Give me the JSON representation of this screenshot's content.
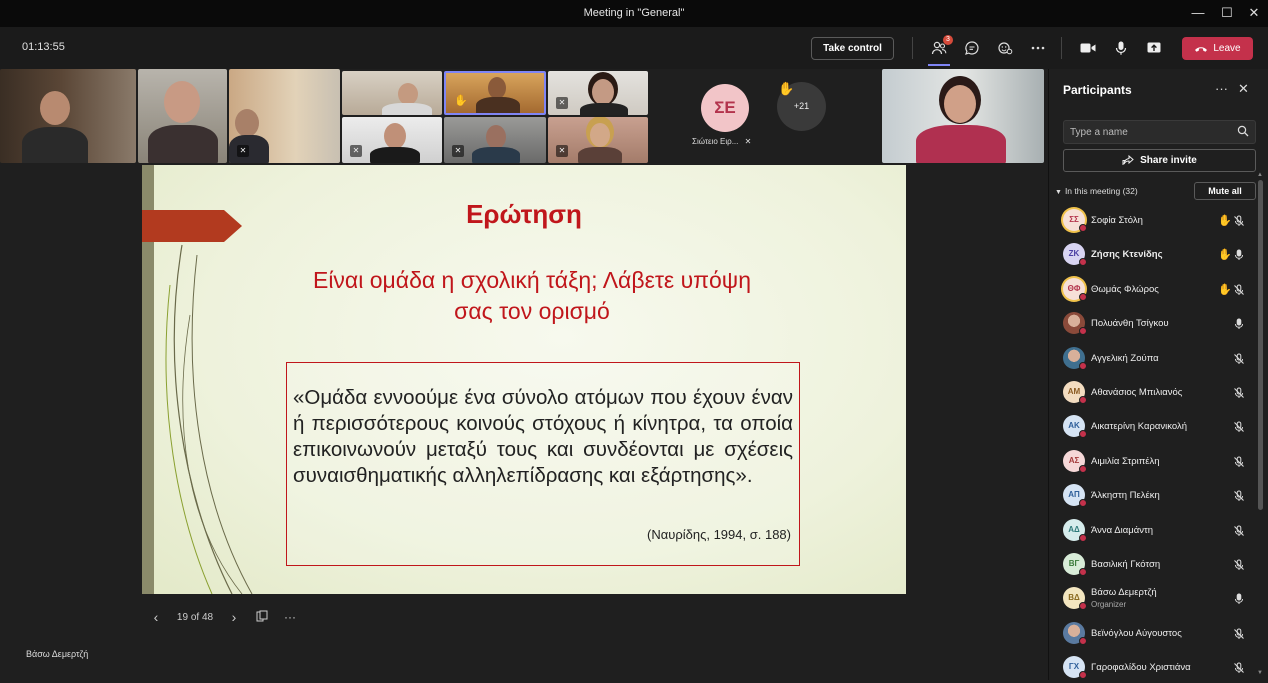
{
  "window": {
    "title": "Meeting in \"General\"",
    "minimize": "—",
    "maximize": "☐",
    "close": "✕"
  },
  "toolbar": {
    "timer": "01:13:55",
    "take_control_label": "Take control",
    "participants_badge": "3",
    "leave_label": "Leave"
  },
  "video_strip": {
    "tile_initials": "ΣΕ",
    "tile_name": "Σιώτειο Ειρ...",
    "overflow_count": "+21"
  },
  "slide": {
    "title": "Ερώτηση",
    "question": "Είναι ομάδα η σχολική τάξη; Λάβετε υπόψη σας τον ορισμό",
    "quote": "«Ομάδα εννοούμε ένα σύνολο ατόμων που έχουν έναν ή περισσότερους κοινούς στόχους ή κίνητρα, τα οποία επικοινωνούν μεταξύ τους και συνδέονται με σχέσεις συναισθηματικής αλληλεπίδρασης και εξάρτησης».",
    "citation": "(Ναυρίδης, 1994, σ. 188)"
  },
  "slide_nav": {
    "page_indicator": "19 of 48"
  },
  "presenter": {
    "name": "Βάσω Δεμερτζή"
  },
  "participants_panel": {
    "title": "Participants",
    "search_placeholder": "Type a name",
    "share_invite_label": "Share invite",
    "section_label": "In this meeting (32)",
    "mute_all_label": "Mute all",
    "participants": [
      {
        "initials": "ΣΣ",
        "name": "Σοφία Στόλη",
        "hand": true,
        "mic": "muted",
        "ring": true,
        "bg": "#f6e0d8",
        "fg": "#b3334c"
      },
      {
        "initials": "ΖΚ",
        "name": "Ζήσης Κτενίδης",
        "hand": true,
        "mic": "on",
        "ring": false,
        "bold": true,
        "bg": "#d8d4f2",
        "fg": "#4b3fa3"
      },
      {
        "initials": "ΘΦ",
        "name": "Θωμάς Φλώρος",
        "hand": true,
        "mic": "muted",
        "ring": true,
        "bg": "#f6e0d8",
        "fg": "#b3334c"
      },
      {
        "initials": "",
        "name": "Πολυάνθη Τσίγκου",
        "hand": false,
        "mic": "on",
        "ring": false,
        "photo": "#8a4a3a"
      },
      {
        "initials": "",
        "name": "Αγγελική Ζούπα",
        "hand": false,
        "mic": "muted",
        "ring": false,
        "photo": "#3f6f8f"
      },
      {
        "initials": "ΑΜ",
        "name": "Αθανάσιος Μπιλιανός",
        "hand": false,
        "mic": "muted",
        "ring": false,
        "bg": "#f3dcc0",
        "fg": "#8a5a20"
      },
      {
        "initials": "ΑΚ",
        "name": "Αικατερίνη Καρανικολή",
        "hand": false,
        "mic": "muted",
        "ring": false,
        "bg": "#d6e4f4",
        "fg": "#2f5f9a"
      },
      {
        "initials": "ΑΣ",
        "name": "Αιμιλία Στριπέλη",
        "hand": false,
        "mic": "muted",
        "ring": false,
        "bg": "#f6d8d8",
        "fg": "#a33a3a"
      },
      {
        "initials": "ΑΠ",
        "name": "Άλκηστη Πελέκη",
        "hand": false,
        "mic": "muted",
        "ring": false,
        "bg": "#d6e4f4",
        "fg": "#2f5f9a"
      },
      {
        "initials": "ΑΔ",
        "name": "Άννα Διαμάντη",
        "hand": false,
        "mic": "muted",
        "ring": false,
        "bg": "#d6ecec",
        "fg": "#2f7a7a"
      },
      {
        "initials": "ΒΓ",
        "name": "Βασιλική Γκότση",
        "hand": false,
        "mic": "muted",
        "ring": false,
        "bg": "#d8ecd8",
        "fg": "#3a7a3a"
      },
      {
        "initials": "ΒΔ",
        "name": "Βάσω Δεμερτζή",
        "sub": "Organizer",
        "hand": false,
        "mic": "on",
        "ring": false,
        "bg": "#f3e6c0",
        "fg": "#8a6a20"
      },
      {
        "initials": "",
        "name": "Βεϊνόγλου Αύγουστος",
        "hand": false,
        "mic": "muted",
        "ring": false,
        "photo": "#5a7aa0"
      },
      {
        "initials": "ΓΧ",
        "name": "Γαροφαλίδου Χριστιάνα",
        "hand": false,
        "mic": "muted",
        "ring": false,
        "bg": "#d6e4f4",
        "fg": "#2f5f9a"
      }
    ]
  },
  "colors": {
    "accent": "#7f85f5",
    "leave": "#c4314b",
    "slide_red": "#c0161b",
    "raised_hand": "#f0c24b"
  }
}
